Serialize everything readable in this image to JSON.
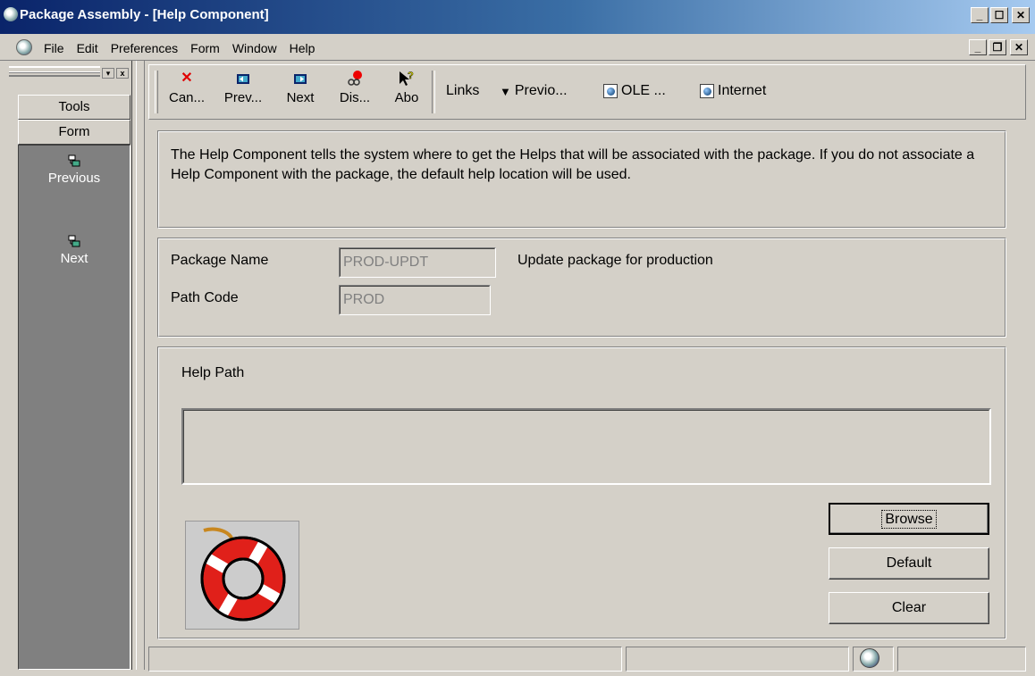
{
  "window": {
    "title": "Package Assembly - [Help Component]",
    "minimize_glyph": "_",
    "restore_glyph": "❐",
    "close_glyph": "✕"
  },
  "menu": {
    "items": [
      "File",
      "Edit",
      "Preferences",
      "Form",
      "Window",
      "Help"
    ]
  },
  "sidebar": {
    "tools_tab": "Tools",
    "form_tab": "Form",
    "items": [
      {
        "label": "Previous",
        "icon": "previous-record-icon"
      },
      {
        "label": "Next",
        "icon": "next-record-icon"
      }
    ]
  },
  "toolbar": {
    "buttons": [
      {
        "label": "Can...",
        "icon": "cancel-icon"
      },
      {
        "label": "Prev...",
        "icon": "previous-icon"
      },
      {
        "label": "Next",
        "icon": "next-icon"
      },
      {
        "label": "Dis...",
        "icon": "display-icon"
      },
      {
        "label": "Abo",
        "icon": "about-help-icon"
      }
    ],
    "links_label": "Links",
    "link_items": [
      {
        "label": "Previo...",
        "icon": "dropdown-triangle-icon"
      },
      {
        "label": "OLE ...",
        "icon": "globe-page-icon"
      },
      {
        "label": "Internet",
        "icon": "globe-page-icon"
      }
    ]
  },
  "info": {
    "text": "The Help Component  tells the system where to get the Helps that will be associated with the package.  If you do not associate a Help Component with the package, the default help location will be used."
  },
  "package": {
    "name_label": "Package Name",
    "name_value": "PROD-UPDT",
    "name_description": "Update package for production",
    "path_label": "Path Code",
    "path_value": "PROD"
  },
  "help_path": {
    "label": "Help Path",
    "value": "",
    "browse_label": "Browse",
    "default_label": "Default",
    "clear_label": "Clear"
  },
  "colors": {
    "title_start": "#0a246a",
    "title_end": "#a6caf0",
    "chrome": "#d4d0c8",
    "sidebar_panel": "#808080"
  }
}
